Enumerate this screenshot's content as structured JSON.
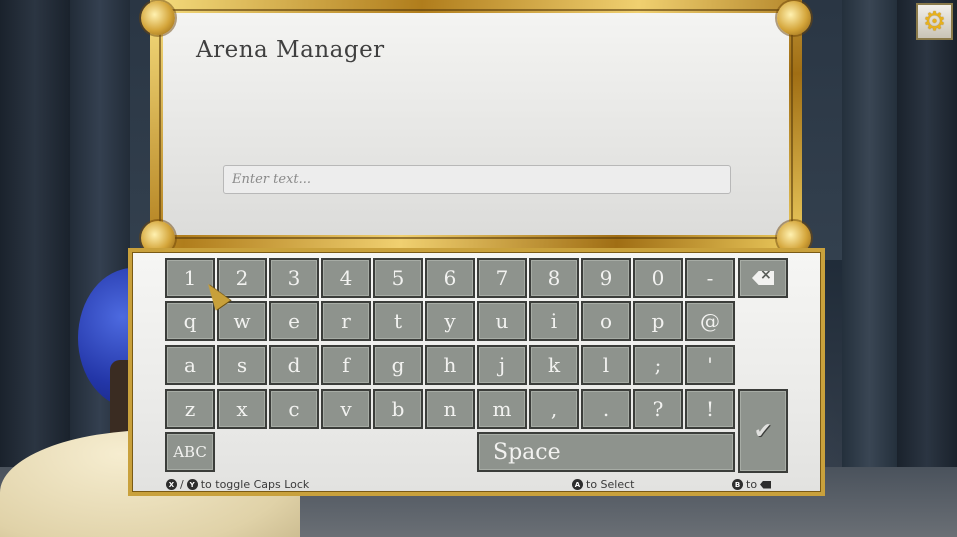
{
  "title_panel": {
    "title": "Arena Manager",
    "input_placeholder": "Enter text..."
  },
  "keyboard": {
    "rows": [
      [
        "1",
        "2",
        "3",
        "4",
        "5",
        "6",
        "7",
        "8",
        "9",
        "0",
        "-"
      ],
      [
        "q",
        "w",
        "e",
        "r",
        "t",
        "y",
        "u",
        "i",
        "o",
        "p",
        "@"
      ],
      [
        "a",
        "s",
        "d",
        "f",
        "g",
        "h",
        "j",
        "k",
        "l",
        ";",
        "'"
      ],
      [
        "z",
        "x",
        "c",
        "v",
        "b",
        "n",
        "m",
        ",",
        ".",
        "?",
        "!"
      ]
    ],
    "abc_label": "ABC",
    "space_label": "Space",
    "backspace_icon": "backspace-icon",
    "confirm_icon": "checkmark-icon"
  },
  "hints": {
    "caps_buttons": [
      "X",
      "Y"
    ],
    "caps_text": "to toggle Caps Lock",
    "select_button": "A",
    "select_text": "to Select",
    "delete_button": "B",
    "delete_text": "to"
  },
  "colors": {
    "gold_frame": "#c79b32",
    "key_fill": "#8e938d",
    "gear": "#e7b11c"
  },
  "settings_icon": "gear-icon"
}
